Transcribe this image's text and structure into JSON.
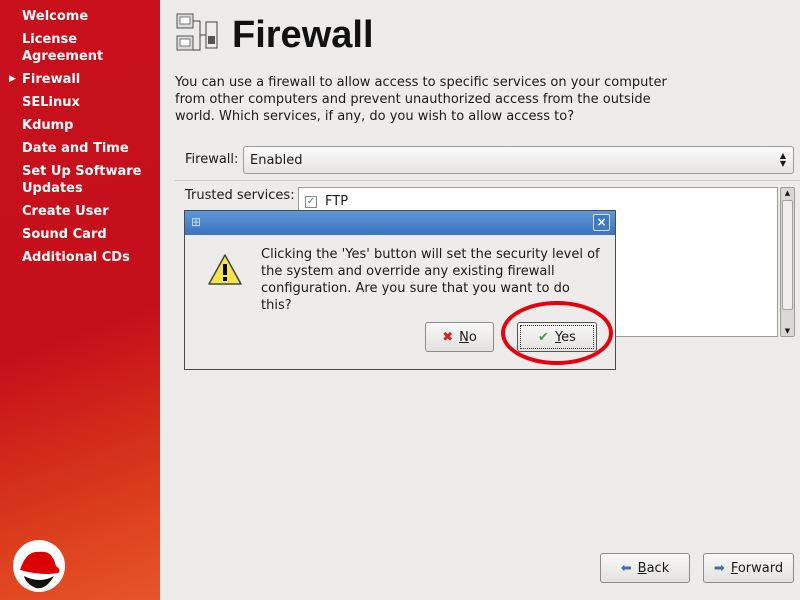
{
  "sidebar": {
    "steps": [
      "Welcome",
      "License Agreement",
      "Firewall",
      "SELinux",
      "Kdump",
      "Date and Time",
      "Set Up Software Updates",
      "Create User",
      "Sound Card",
      "Additional CDs"
    ],
    "current": "Firewall"
  },
  "main": {
    "title": "Firewall",
    "description": "You can use a firewall to allow access to specific services on your computer from other computers and prevent unauthorized access from the outside world.  Which services, if any, do you wish to allow access to?",
    "firewall_label": "Firewall:",
    "firewall_value": "Enabled",
    "trusted_label": "Trusted services:",
    "services": [
      {
        "name": "FTP",
        "checked": true
      }
    ]
  },
  "dialog": {
    "message": "Clicking the 'Yes' button will set the security level of the system and override any existing firewall configuration.  Are you sure that you want to do this?",
    "no_label": "No",
    "yes_label": "Yes",
    "close": "×"
  },
  "nav": {
    "back_label": "Back",
    "forward_label": "Forward"
  },
  "colors": {
    "highlight": "#e4000f",
    "sidebar": "#c8101c",
    "titlebar": "#3a74c0"
  }
}
